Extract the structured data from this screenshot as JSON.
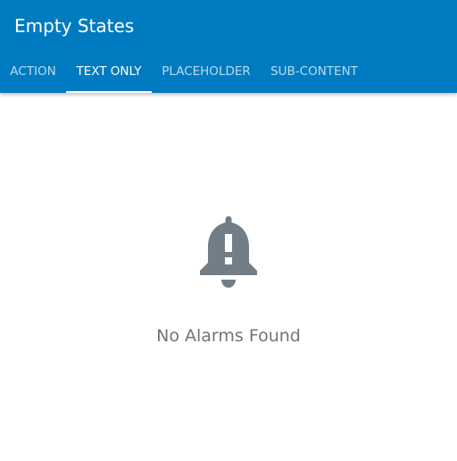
{
  "app": {
    "title": "Empty States"
  },
  "tabs": [
    {
      "label": "ACTION",
      "active": false
    },
    {
      "label": "TEXT ONLY",
      "active": true
    },
    {
      "label": "PLACEHOLDER",
      "active": false
    },
    {
      "label": "SUB-CONTENT",
      "active": false
    }
  ],
  "empty_state": {
    "icon": "alarm-bell-icon",
    "message": "No Alarms Found"
  },
  "colors": {
    "app_bar": "#007bc1",
    "tab_text": "#ffffff",
    "icon": "#727e87",
    "message": "#6f757b"
  }
}
